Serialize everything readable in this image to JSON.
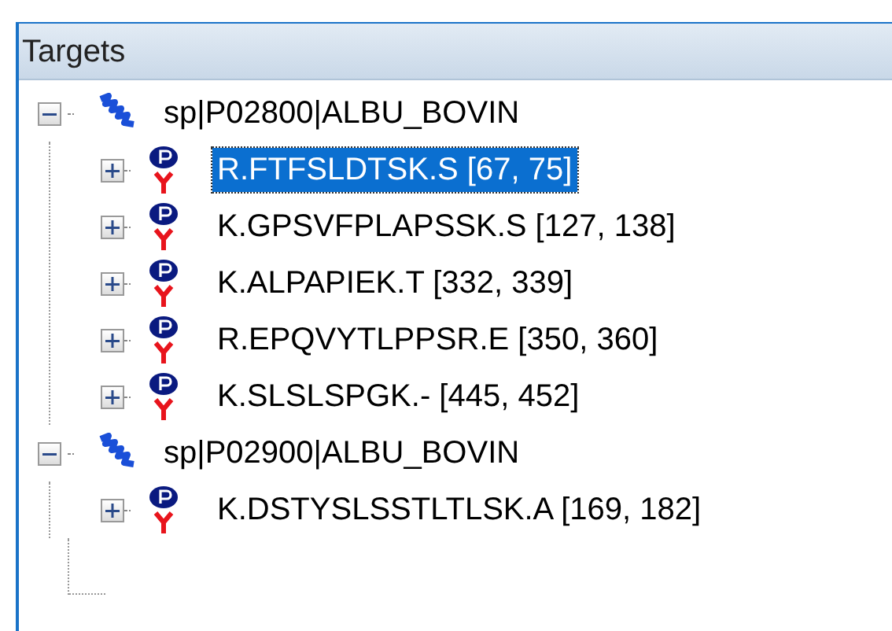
{
  "panel": {
    "title": "Targets"
  },
  "tree": [
    {
      "label": "sp|P02800|ALBU_BOVIN",
      "kind": "protein",
      "expanded": true,
      "selected": false,
      "children": [
        {
          "label": "R.FTFSLDTSK.S [67, 75]",
          "kind": "peptide",
          "expanded": false,
          "selected": true
        },
        {
          "label": "K.GPSVFPLAPSSK.S [127, 138]",
          "kind": "peptide",
          "expanded": false,
          "selected": false
        },
        {
          "label": "K.ALPAPIEK.T [332, 339]",
          "kind": "peptide",
          "expanded": false,
          "selected": false
        },
        {
          "label": "R.EPQVYTLPPSR.E [350, 360]",
          "kind": "peptide",
          "expanded": false,
          "selected": false
        },
        {
          "label": "K.SLSLSPGK.- [445, 452]",
          "kind": "peptide",
          "expanded": false,
          "selected": false
        }
      ]
    },
    {
      "label": "sp|P02900|ALBU_BOVIN",
      "kind": "protein",
      "expanded": true,
      "selected": false,
      "children": [
        {
          "label": "K.DSTYSLSSTLTLSK.A [169, 182]",
          "kind": "peptide",
          "expanded": false,
          "selected": false
        }
      ]
    }
  ]
}
